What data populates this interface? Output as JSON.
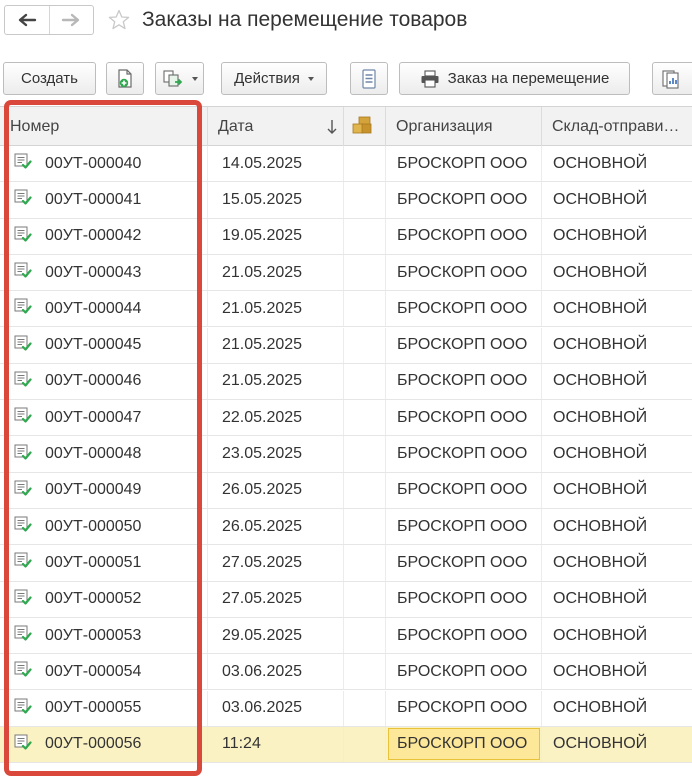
{
  "window": {
    "title": "Заказы на перемещение товаров"
  },
  "toolbar": {
    "create_label": "Создать",
    "actions_label": "Действия",
    "transfer_order_label": "Заказ на перемещение"
  },
  "table": {
    "columns": {
      "number": "Номер",
      "date": "Дата",
      "organization": "Организация",
      "warehouse": "Склад-отправи…"
    },
    "rows": [
      {
        "number": "00УТ-000040",
        "date": "14.05.2025",
        "organization": "БРОСКОРП ООО",
        "warehouse": "ОСНОВНОЙ"
      },
      {
        "number": "00УТ-000041",
        "date": "15.05.2025",
        "organization": "БРОСКОРП ООО",
        "warehouse": "ОСНОВНОЙ"
      },
      {
        "number": "00УТ-000042",
        "date": "19.05.2025",
        "organization": "БРОСКОРП ООО",
        "warehouse": "ОСНОВНОЙ"
      },
      {
        "number": "00УТ-000043",
        "date": "21.05.2025",
        "organization": "БРОСКОРП ООО",
        "warehouse": "ОСНОВНОЙ"
      },
      {
        "number": "00УТ-000044",
        "date": "21.05.2025",
        "organization": "БРОСКОРП ООО",
        "warehouse": "ОСНОВНОЙ"
      },
      {
        "number": "00УТ-000045",
        "date": "21.05.2025",
        "organization": "БРОСКОРП ООО",
        "warehouse": "ОСНОВНОЙ"
      },
      {
        "number": "00УТ-000046",
        "date": "21.05.2025",
        "organization": "БРОСКОРП ООО",
        "warehouse": "ОСНОВНОЙ"
      },
      {
        "number": "00УТ-000047",
        "date": "22.05.2025",
        "organization": "БРОСКОРП ООО",
        "warehouse": "ОСНОВНОЙ"
      },
      {
        "number": "00УТ-000048",
        "date": "23.05.2025",
        "organization": "БРОСКОРП ООО",
        "warehouse": "ОСНОВНОЙ"
      },
      {
        "number": "00УТ-000049",
        "date": "26.05.2025",
        "organization": "БРОСКОРП ООО",
        "warehouse": "ОСНОВНОЙ"
      },
      {
        "number": "00УТ-000050",
        "date": "26.05.2025",
        "organization": "БРОСКОРП ООО",
        "warehouse": "ОСНОВНОЙ"
      },
      {
        "number": "00УТ-000051",
        "date": "27.05.2025",
        "organization": "БРОСКОРП ООО",
        "warehouse": "ОСНОВНОЙ"
      },
      {
        "number": "00УТ-000052",
        "date": "27.05.2025",
        "organization": "БРОСКОРП ООО",
        "warehouse": "ОСНОВНОЙ"
      },
      {
        "number": "00УТ-000053",
        "date": "29.05.2025",
        "organization": "БРОСКОРП ООО",
        "warehouse": "ОСНОВНОЙ"
      },
      {
        "number": "00УТ-000054",
        "date": "03.06.2025",
        "organization": "БРОСКОРП ООО",
        "warehouse": "ОСНОВНОЙ"
      },
      {
        "number": "00УТ-000055",
        "date": "03.06.2025",
        "organization": "БРОСКОРП ООО",
        "warehouse": "ОСНОВНОЙ"
      },
      {
        "number": "00УТ-000056",
        "date": "11:24",
        "organization": "БРОСКОРП ООО",
        "warehouse": "ОСНОВНОЙ",
        "selected": true
      }
    ]
  },
  "icons": {
    "back": "arrow-left-icon",
    "forward": "arrow-right-icon",
    "favorite": "star-icon",
    "create_copy": "document-add-icon",
    "create_based_on": "create-based-on-icon",
    "list_settings": "list-settings-icon",
    "print": "printer-icon",
    "reports": "reports-icon",
    "sort_desc": "sort-descending-icon",
    "extra_column": "boxes-icon",
    "row_document": "posted-document-icon"
  },
  "colors": {
    "highlight_frame": "#d9483b",
    "selected_row": "#fbf2c4",
    "focused_cell": "#fde89a",
    "posted_check": "#2fa84f"
  }
}
